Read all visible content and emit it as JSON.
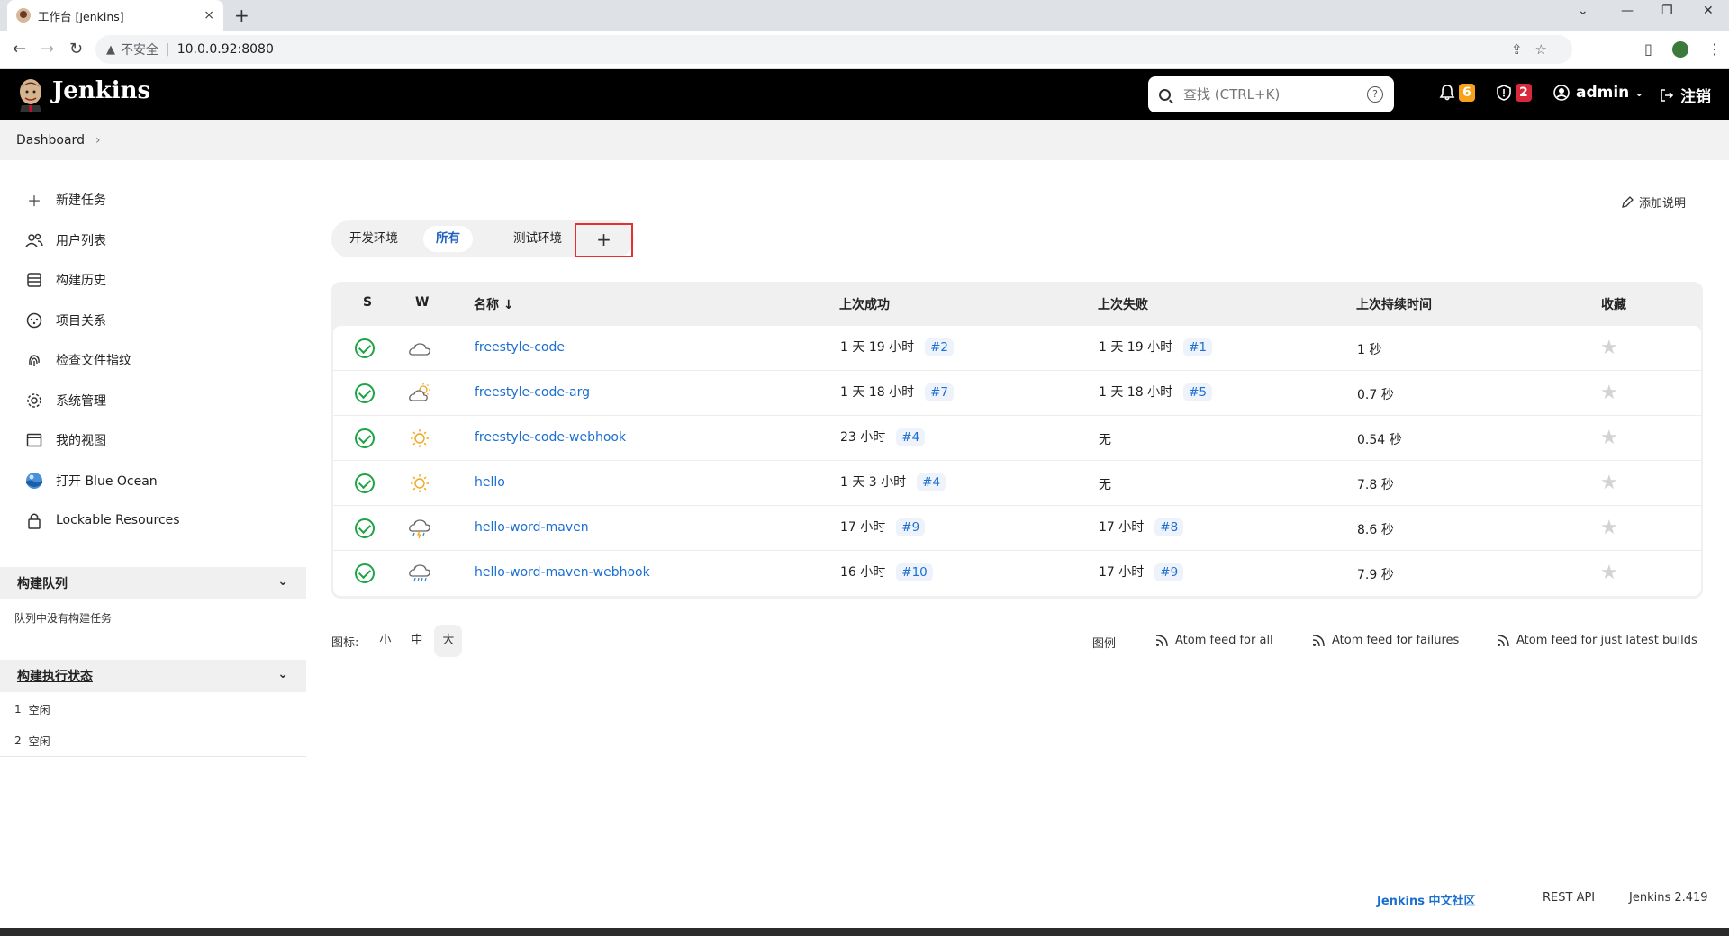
{
  "browser": {
    "tab_title": "工作台 [Jenkins]",
    "tab_close": "×",
    "new_tab": "+",
    "insecure_label": "不安全",
    "url": "10.0.0.92:8080",
    "window_controls": [
      "minimize-icon",
      "restore-icon",
      "close-icon"
    ]
  },
  "header": {
    "brand": "Jenkins",
    "search_placeholder": "查找 (CTRL+K)",
    "search_help": "?",
    "notifications_count": "6",
    "security_count": "2",
    "user": "admin",
    "logout": "注销",
    "accent_orange": "#f7a21b",
    "accent_red": "#d9283b"
  },
  "breadcrumb": {
    "item": "Dashboard"
  },
  "sidebar": {
    "items": [
      {
        "label": "新建任务",
        "icon": "plus-icon"
      },
      {
        "label": "用户列表",
        "icon": "people-icon"
      },
      {
        "label": "构建历史",
        "icon": "history-icon"
      },
      {
        "label": "项目关系",
        "icon": "relations-icon"
      },
      {
        "label": "检查文件指纹",
        "icon": "fingerprint-icon"
      },
      {
        "label": "系统管理",
        "icon": "gear-icon"
      },
      {
        "label": "我的视图",
        "icon": "window-icon"
      },
      {
        "label": "打开 Blue Ocean",
        "icon": "blue-ocean-icon"
      },
      {
        "label": "Lockable Resources",
        "icon": "lock-icon"
      }
    ],
    "queue": {
      "title": "构建队列",
      "empty": "队列中没有构建任务"
    },
    "executors": {
      "title": "构建执行状态",
      "rows": [
        {
          "num": "1",
          "status": "空闲"
        },
        {
          "num": "2",
          "status": "空闲"
        }
      ]
    }
  },
  "main": {
    "add_description": "添加说明",
    "view_tabs": [
      "开发环境",
      "所有",
      "测试环境"
    ],
    "active_tab": "所有",
    "add_tab": "+",
    "table": {
      "headers": {
        "s": "S",
        "w": "W",
        "name": "名称 ↓",
        "last_success": "上次成功",
        "last_failure": "上次失败",
        "last_duration": "上次持续时间",
        "fav": "收藏"
      },
      "rows": [
        {
          "weather": "cloudy",
          "name": "freestyle-code",
          "success": "1 天 19 小时",
          "success_build": "#2",
          "failure": "1 天 19 小时",
          "failure_build": "#1",
          "duration": "1 秒"
        },
        {
          "weather": "partly-sunny",
          "name": "freestyle-code-arg",
          "success": "1 天 18 小时",
          "success_build": "#7",
          "failure": "1 天 18 小时",
          "failure_build": "#5",
          "duration": "0.7 秒"
        },
        {
          "weather": "sunny",
          "name": "freestyle-code-webhook",
          "success": "23 小时",
          "success_build": "#4",
          "failure": "无",
          "failure_build": "",
          "duration": "0.54 秒"
        },
        {
          "weather": "sunny",
          "name": "hello",
          "success": "1 天 3 小时",
          "success_build": "#4",
          "failure": "无",
          "failure_build": "",
          "duration": "7.8 秒"
        },
        {
          "weather": "thunderstorm",
          "name": "hello-word-maven",
          "success": "17 小时",
          "success_build": "#9",
          "failure": "17 小时",
          "failure_build": "#8",
          "duration": "8.6 秒"
        },
        {
          "weather": "rain",
          "name": "hello-word-maven-webhook",
          "success": "16 小时",
          "success_build": "#10",
          "failure": "17 小时",
          "failure_build": "#9",
          "duration": "7.9 秒"
        }
      ]
    },
    "icon_size": {
      "label": "图标:",
      "options": [
        "小",
        "中",
        "大"
      ],
      "active": "大"
    },
    "legend": "图例",
    "feeds": [
      "Atom feed for all",
      "Atom feed for failures",
      "Atom feed for just latest builds"
    ]
  },
  "footer": {
    "community": "Jenkins 中文社区",
    "rest_api": "REST API",
    "version": "Jenkins 2.419"
  }
}
